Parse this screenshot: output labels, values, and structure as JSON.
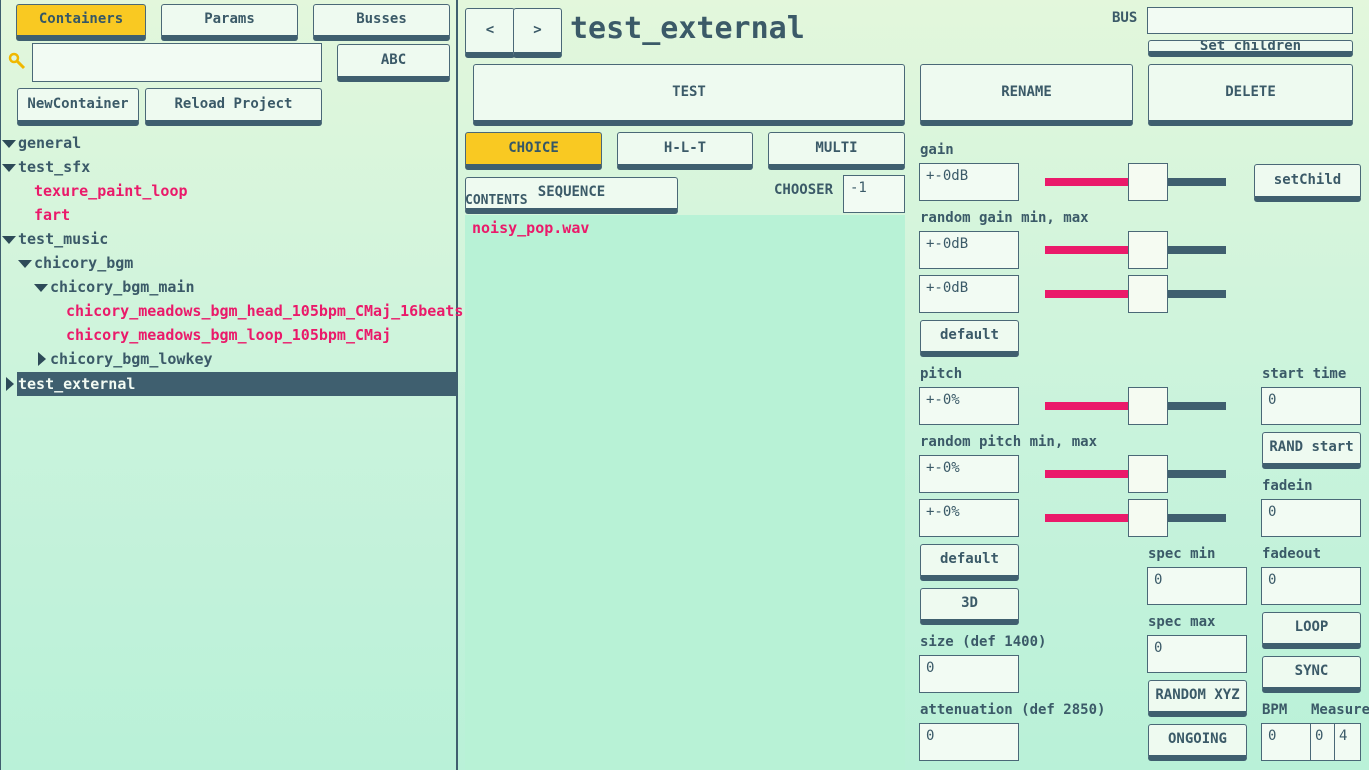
{
  "left_panel": {
    "tabs": [
      "Containers",
      "Params",
      "Busses"
    ],
    "abc_label": "ABC",
    "search_value": "",
    "new_container_label": "NewContainer",
    "reload_project_label": "Reload Project",
    "tree": [
      {
        "label": "general",
        "expander": "down"
      },
      {
        "label": "test_sfx",
        "expander": "down"
      },
      {
        "label": "texure_paint_loop",
        "type": "sound"
      },
      {
        "label": "fart",
        "type": "sound"
      },
      {
        "label": "test_music",
        "expander": "down"
      },
      {
        "label": "chicory_bgm",
        "expander": "down"
      },
      {
        "label": "chicory_bgm_main",
        "expander": "down"
      },
      {
        "label": "chicory_meadows_bgm_head_105bpm_CMaj_16beats",
        "type": "sound"
      },
      {
        "label": "chicory_meadows_bgm_loop_105bpm_CMaj",
        "type": "sound"
      },
      {
        "label": "chicory_bgm_lowkey",
        "expander": "right"
      },
      {
        "label": "test_external",
        "expander": "right",
        "selected": true
      }
    ]
  },
  "header": {
    "back_label": "<",
    "forward_label": ">",
    "title": "test_external",
    "bus_label": "BUS",
    "bus_value": "",
    "set_children_label": "Set children"
  },
  "actions": {
    "test": "TEST",
    "rename": "RENAME",
    "delete": "DELETE"
  },
  "modes": {
    "choice": "CHOICE",
    "hlt": "H-L-T",
    "multi": "MULTI",
    "sequence": "SEQUENCE",
    "selected": "CHOICE"
  },
  "contents": {
    "label": "CONTENTS",
    "chooser_label": "CHOOSER",
    "chooser_value": "-1",
    "items": [
      "noisy_pop.wav"
    ]
  },
  "params": {
    "gain_label": "gain",
    "gain_value": "+-0dB",
    "set_child_label": "setChild",
    "random_gain_label": "random gain min, max",
    "random_gain_min": "+-0dB",
    "random_gain_max": "+-0dB",
    "default_label": "default",
    "pitch_label": "pitch",
    "pitch_value": "+-0%",
    "random_pitch_label": "random pitch min, max",
    "random_pitch_min": "+-0%",
    "random_pitch_max": "+-0%",
    "default2_label": "default",
    "three_d_label": "3D",
    "size_label": "size (def 1400)",
    "size_value": "0",
    "attenuation_label": "attenuation (def 2850)",
    "attenuation_value": "0",
    "spec_min_label": "spec min",
    "spec_min_value": "0",
    "spec_max_label": "spec max",
    "spec_max_value": "0",
    "random_xyz_label": "RANDOM XYZ",
    "ongoing_label": "ONGOING",
    "start_time_label": "start time",
    "start_time_value": "0",
    "rand_start_label": "RAND start",
    "fadein_label": "fadein",
    "fadein_value": "0",
    "fadeout_label": "fadeout",
    "fadeout_value": "0",
    "loop_label": "LOOP",
    "sync_label": "SYNC",
    "bpm_label": "BPM",
    "bpm_value": "0",
    "measure_label": "Measure",
    "measure_value_1": "0",
    "measure_value_2": "4"
  },
  "sliders": {
    "gain": 0.39,
    "random_gain_min": 0.39,
    "random_gain_max": 0.39,
    "pitch": 0.39,
    "random_pitch_min": 0.39,
    "random_pitch_max": 0.39
  },
  "colors": {
    "accent_selected": "#f9c922",
    "sound_item": "#ea1a6a",
    "slider_fill": "#ea1a6a",
    "tree_selected_bg": "#3f5f6f",
    "panel_border": "#3f5f6f"
  }
}
